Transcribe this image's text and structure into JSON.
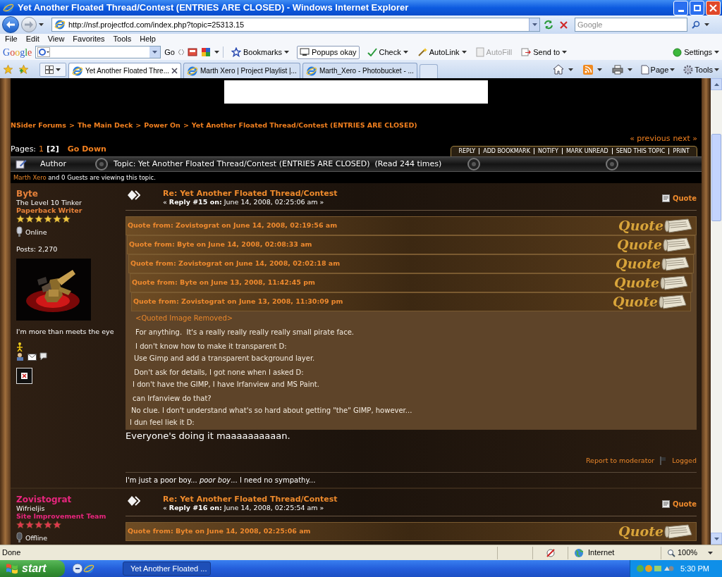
{
  "window": {
    "title": "Yet Another Floated Thread/Contest (ENTRIES ARE CLOSED) - Windows Internet Explorer"
  },
  "address_bar": {
    "url": "http://nsf.projectfcd.com/index.php?topic=25313.15"
  },
  "search": {
    "placeholder": "Google"
  },
  "menu": [
    "File",
    "Edit",
    "View",
    "Favorites",
    "Tools",
    "Help"
  ],
  "google_toolbar": {
    "logo": "Google",
    "go": "Go",
    "buttons": [
      {
        "label": "Bookmarks",
        "kind": "menu",
        "disabled": false
      },
      {
        "label": "Popups okay",
        "kind": "toggle",
        "disabled": false
      },
      {
        "label": "Check",
        "kind": "menu",
        "disabled": false
      },
      {
        "label": "AutoLink",
        "kind": "menu",
        "disabled": false
      },
      {
        "label": "AutoFill",
        "kind": "plain",
        "disabled": true
      },
      {
        "label": "Send to",
        "kind": "menu",
        "disabled": false
      }
    ],
    "settings": "Settings"
  },
  "tabs": [
    {
      "label": "Yet Another Floated Thre...",
      "selected": true
    },
    {
      "label": "Marth Xero | Project Playlist |...",
      "selected": false
    },
    {
      "label": "Marth_Xero - Photobucket - ...",
      "selected": false
    }
  ],
  "command_bar": [
    "Page",
    "Tools"
  ],
  "forum": {
    "breadcrumb": {
      "separator": ">",
      "items": [
        "NSider Forums",
        "The Main Deck",
        "Power On",
        "Yet Another Floated Thread/Contest (ENTRIES ARE CLOSED)"
      ]
    },
    "prev": "« previous",
    "next": "next »",
    "pages": {
      "label": "Pages:",
      "items": [
        {
          "label": "1",
          "selected": false
        },
        {
          "label": "[2]",
          "selected": true
        }
      ],
      "go_down": "Go Down"
    },
    "actions": [
      "REPLY",
      "ADD BOOKMARK",
      "NOTIFY",
      "MARK UNREAD",
      "SEND THIS TOPIC",
      "PRINT"
    ],
    "header": {
      "author": "Author",
      "topic": "Topic: Yet Another Floated Thread/Contest (ENTRIES ARE CLOSED)  (Read 244 times)"
    },
    "viewing": {
      "user": "Marth Xero",
      "text": "and 0 Guests are viewing this topic."
    },
    "posts": [
      {
        "author": {
          "name": "Byte",
          "color": "#e8823a",
          "title": "The Level 10 Tinker",
          "group": "Paperback Writer",
          "stars": 6,
          "status": "Online",
          "online": true,
          "posts": "Posts: 2,270",
          "personal_text": "I'm more than meets the eye",
          "contact_icons": true,
          "broken_image": true
        },
        "subject": "Re: Yet Another Floated Thread/Contest",
        "reply": "« **Reply #15 on:** June 14, 2008, 02:25:06 am »",
        "quote_button": "Quote",
        "quotes": [
          {
            "header": "Quote from: Zovistograt on June 14, 2008, 02:19:56 am",
            "badge": "Quote",
            "children": [
              {
                "header": "Quote from: Byte on June 14, 2008, 02:08:33 am",
                "badge": "Quote",
                "children": [
                  {
                    "header": "Quote from: Zovistograt on June 14, 2008, 02:02:18 am",
                    "badge": "Quote",
                    "children": [
                      {
                        "header": "Quote from: Byte on June 13, 2008, 11:42:45 pm",
                        "badge": "Quote",
                        "children": [
                          {
                            "header": "Quote from: Zovistograt on June 13, 2008, 11:30:09 pm",
                            "badge": "Quote",
                            "text": [
                              {
                                "kind": "removed",
                                "text": "<Quoted Image Removed>"
                              },
                              {
                                "kind": "plain",
                                "text": "For anything.  It's a really really really really small pirate face."
                              },
                              {
                                "kind": "plain",
                                "text": "I don't know how to make it transparent D:"
                              }
                            ]
                          }
                        ],
                        "text": [
                          {
                            "kind": "plain",
                            "text": "Use Gimp and add a transparent background layer."
                          },
                          {
                            "kind": "plain",
                            "text": "Don't ask for details, I got none when I asked D:"
                          }
                        ]
                      }
                    ],
                    "text": [
                      {
                        "kind": "plain",
                        "text": "I don't have the GIMP, I have Irfanview and MS Paint."
                      },
                      {
                        "kind": "plain",
                        "text": "can Irfanview do that?"
                      }
                    ]
                  }
                ],
                "text": [
                  {
                    "kind": "plain",
                    "text": "No clue. I don't understand what's so hard about getting \"the\" GIMP, however..."
                  }
                ]
              }
            ],
            "text": [
              {
                "kind": "plain",
                "text": "I dun feel liek it D:"
              }
            ]
          }
        ],
        "message": "Everyone's doing it maaaaaaaaaan.",
        "report": "Report to moderator",
        "logged": "Logged",
        "signature": "I'm just a poor boy... *poor boy*... I need no sympathy..."
      },
      {
        "author": {
          "name": "Zovistograt",
          "color": "#e8267e",
          "title": "Wifrieljis",
          "group": "Site Improvement Team",
          "stars": 5,
          "status": "Offline",
          "online": false
        },
        "subject": "Re: Yet Another Floated Thread/Contest",
        "reply": "« **Reply #16 on:** June 14, 2008, 02:25:54 am »",
        "quote_button": "Quote",
        "quotes": [
          {
            "header": "Quote from: Byte on June 14, 2008, 02:25:06 am",
            "badge": "Quote"
          }
        ]
      }
    ]
  },
  "status_bar": {
    "text": "Done",
    "zone": "Internet",
    "zoom": "100%"
  },
  "taskbar": {
    "start": "start",
    "tasks": [
      {
        "label": "Yet Another Floated ...",
        "selected": true
      }
    ],
    "clock": "5:30 PM"
  }
}
